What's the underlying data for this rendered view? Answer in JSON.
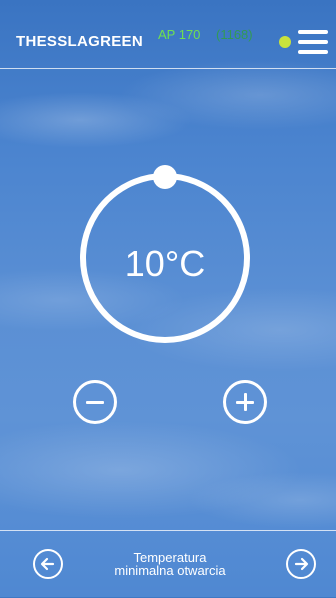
{
  "header": {
    "brand": "THESSLAGREEN",
    "model": "AP 170",
    "serial": "(1168)",
    "status_color": "#c8e23c",
    "menu_icon": "hamburger-menu-icon"
  },
  "dial": {
    "value": "10°C"
  },
  "controls": {
    "decrease_icon": "minus-circle-icon",
    "increase_icon": "plus-circle-icon"
  },
  "footer": {
    "label_line1": "Temperatura",
    "label_line2": "minimalna otwarcia",
    "prev_icon": "arrow-left-circle-icon",
    "next_icon": "arrow-right-circle-icon"
  },
  "colors": {
    "sky": "#4b84cf",
    "model_text": "#6fe14f",
    "serial_text": "#2ea532"
  }
}
